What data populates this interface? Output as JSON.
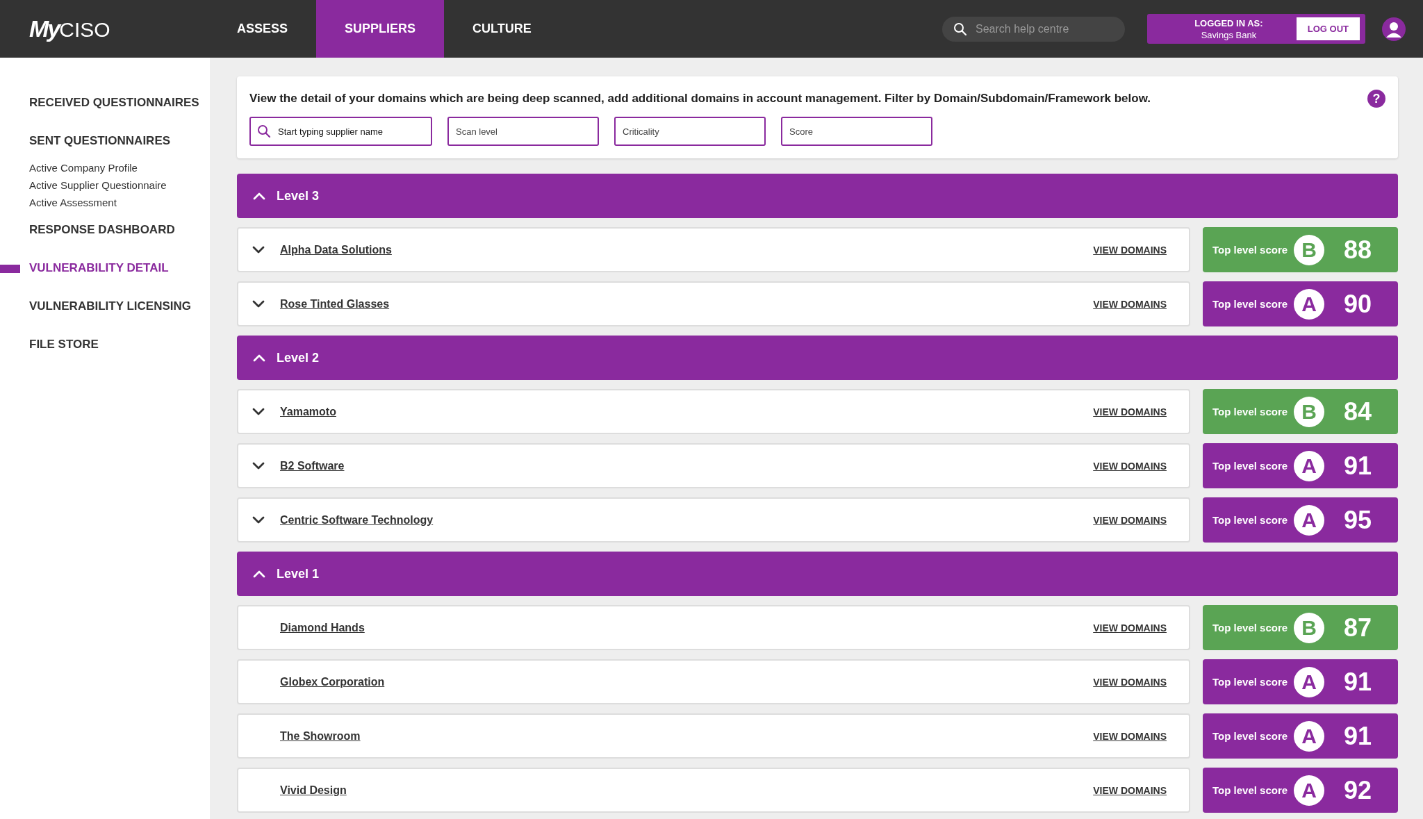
{
  "header": {
    "logo": {
      "bold": "My",
      "light": "CISO"
    },
    "nav": [
      {
        "label": "ASSESS",
        "selected": false
      },
      {
        "label": "SUPPLIERS",
        "selected": true
      },
      {
        "label": "CULTURE",
        "selected": false
      }
    ],
    "search": {
      "placeholder": "Search help centre"
    },
    "account": {
      "caption": "LOGGED IN AS:",
      "name": "Savings Bank",
      "logout": "LOG OUT"
    }
  },
  "sidebar": {
    "items": [
      {
        "label": "RECEIVED QUESTIONNAIRES",
        "kind": "section",
        "selected": false
      },
      {
        "label": "SENT QUESTIONNAIRES",
        "kind": "section",
        "selected": false
      },
      {
        "label": "Active Company Profile",
        "kind": "sub",
        "selected": false
      },
      {
        "label": "Active Supplier Questionnaire",
        "kind": "sub",
        "selected": false
      },
      {
        "label": "Active Assessment",
        "kind": "sub",
        "selected": false
      },
      {
        "label": "RESPONSE DASHBOARD",
        "kind": "section",
        "selected": false
      },
      {
        "label": "VULNERABILITY DETAIL",
        "kind": "section",
        "selected": true
      },
      {
        "label": "VULNERABILITY LICENSING",
        "kind": "section",
        "selected": false
      },
      {
        "label": "FILE STORE",
        "kind": "section",
        "selected": false
      }
    ]
  },
  "intro": {
    "text": "View the detail of your domains which are being deep scanned, add additional domains in account management. Filter by Domain/Subdomain/Framework below.",
    "help": "?",
    "filters": [
      {
        "placeholder": "Start typing supplier name",
        "kind": "search"
      },
      {
        "placeholder": "Scan level",
        "kind": "plain"
      },
      {
        "placeholder": "Criticality",
        "kind": "plain"
      },
      {
        "placeholder": "Score",
        "kind": "plain"
      }
    ]
  },
  "groups": [
    {
      "title": "Level 3",
      "expanded": true,
      "suppliers": [
        {
          "name": "Alpha Data Solutions",
          "expandable": true,
          "link": "VIEW DOMAINS",
          "score_label": "Top level score",
          "grade": "B",
          "score": "88",
          "color": "#5aa454"
        },
        {
          "name": "Rose Tinted Glasses",
          "expandable": true,
          "link": "VIEW DOMAINS",
          "score_label": "Top level score",
          "grade": "A",
          "score": "90",
          "color": "#8a2a9e"
        }
      ]
    },
    {
      "title": "Level 2",
      "expanded": true,
      "suppliers": [
        {
          "name": "Yamamoto",
          "expandable": true,
          "link": "VIEW DOMAINS",
          "score_label": "Top level score",
          "grade": "B",
          "score": "84",
          "color": "#5aa454"
        },
        {
          "name": "B2 Software",
          "expandable": true,
          "link": "VIEW DOMAINS",
          "score_label": "Top level score",
          "grade": "A",
          "score": "91",
          "color": "#8a2a9e"
        },
        {
          "name": "Centric Software Technology",
          "expandable": true,
          "link": "VIEW DOMAINS",
          "score_label": "Top level score",
          "grade": "A",
          "score": "95",
          "color": "#8a2a9e"
        }
      ]
    },
    {
      "title": "Level 1",
      "expanded": true,
      "suppliers": [
        {
          "name": "Diamond Hands",
          "expandable": false,
          "link": "VIEW DOMAINS",
          "score_label": "Top level score",
          "grade": "B",
          "score": "87",
          "color": "#5aa454"
        },
        {
          "name": "Globex Corporation",
          "expandable": false,
          "link": "VIEW DOMAINS",
          "score_label": "Top level score",
          "grade": "A",
          "score": "91",
          "color": "#8a2a9e"
        },
        {
          "name": "The Showroom",
          "expandable": false,
          "link": "VIEW DOMAINS",
          "score_label": "Top level score",
          "grade": "A",
          "score": "91",
          "color": "#8a2a9e"
        },
        {
          "name": "Vivid Design",
          "expandable": false,
          "link": "VIEW DOMAINS",
          "score_label": "Top level score",
          "grade": "A",
          "score": "92",
          "color": "#8a2a9e"
        }
      ]
    }
  ]
}
